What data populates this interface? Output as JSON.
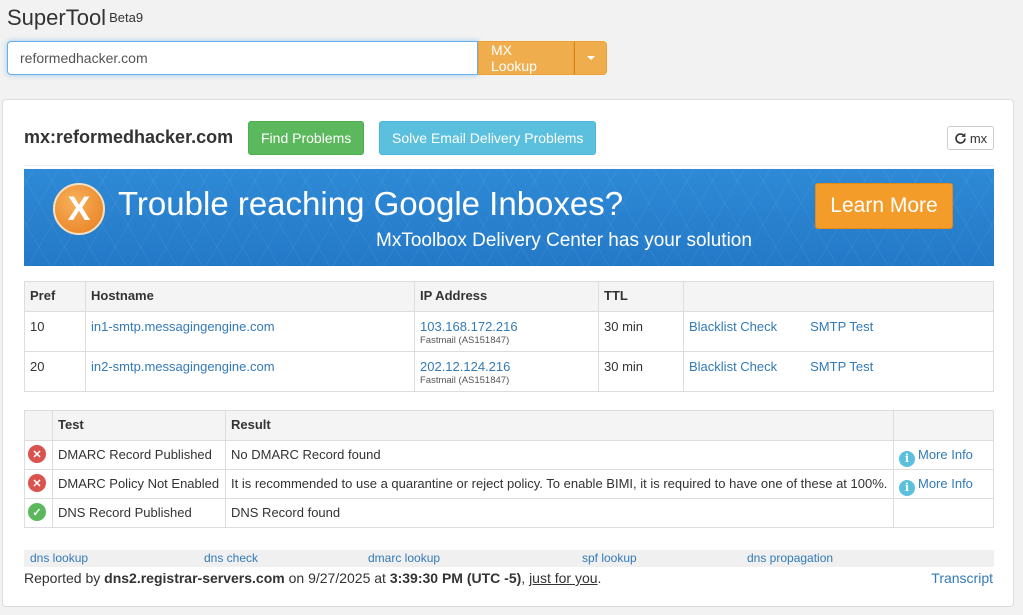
{
  "app": {
    "title": "SuperTool",
    "badge": "Beta9"
  },
  "search": {
    "value": "reformedhacker.com",
    "button_label": "MX Lookup"
  },
  "result": {
    "title": "mx:reformedhacker.com",
    "find_problems": "Find Problems",
    "solve_delivery": "Solve Email Delivery Problems",
    "refresh_label": "mx"
  },
  "banner": {
    "logo_letter": "X",
    "headline": "Trouble reaching Google Inboxes?",
    "subline": "MxToolbox Delivery Center has your solution",
    "cta": "Learn More",
    "colors": {
      "background": "#2b85d1",
      "cta": "#f39c2a"
    }
  },
  "mx_table": {
    "headers": [
      "Pref",
      "Hostname",
      "IP Address",
      "TTL",
      ""
    ],
    "rows": [
      {
        "pref": "10",
        "hostname": "in1-smtp.messagingengine.com",
        "ip": "103.168.172.216",
        "asn": "Fastmail (AS151847)",
        "ttl": "30 min",
        "action1": "Blacklist Check",
        "action2": "SMTP Test"
      },
      {
        "pref": "20",
        "hostname": "in2-smtp.messagingengine.com",
        "ip": "202.12.124.216",
        "asn": "Fastmail (AS151847)",
        "ttl": "30 min",
        "action1": "Blacklist Check",
        "action2": "SMTP Test"
      }
    ]
  },
  "test_table": {
    "headers": [
      "",
      "Test",
      "Result",
      ""
    ],
    "rows": [
      {
        "status": "error",
        "status_icon": "x-circle-icon",
        "test": "DMARC Record Published",
        "result": "No DMARC Record found",
        "more": "More Info"
      },
      {
        "status": "error",
        "status_icon": "x-circle-icon",
        "test": "DMARC Policy Not Enabled",
        "result": "It is recommended to use a quarantine or reject policy. To enable BIMI, it is required to have one of these at 100%.",
        "more": "More Info"
      },
      {
        "status": "ok",
        "status_icon": "check-circle-icon",
        "test": "DNS Record Published",
        "result": "DNS Record found",
        "more": ""
      }
    ]
  },
  "footer": {
    "links": [
      "dns lookup",
      "dns check",
      "dmarc lookup",
      "spf lookup",
      "dns propagation"
    ],
    "reported_prefix": "Reported by ",
    "server": "dns2.registrar-servers.com",
    "on": " on 9/27/2025 at ",
    "time": "3:39:30 PM (UTC -5)",
    "comma": ", ",
    "just_for_you": "just for you",
    "period": ".",
    "transcript": "Transcript"
  },
  "colors": {
    "link": "#337ab7",
    "orange_button": "#f0ad4e",
    "green_button": "#5cb85c",
    "blue_button": "#5bc0de",
    "error": "#d9534f",
    "ok": "#5cb85c"
  }
}
